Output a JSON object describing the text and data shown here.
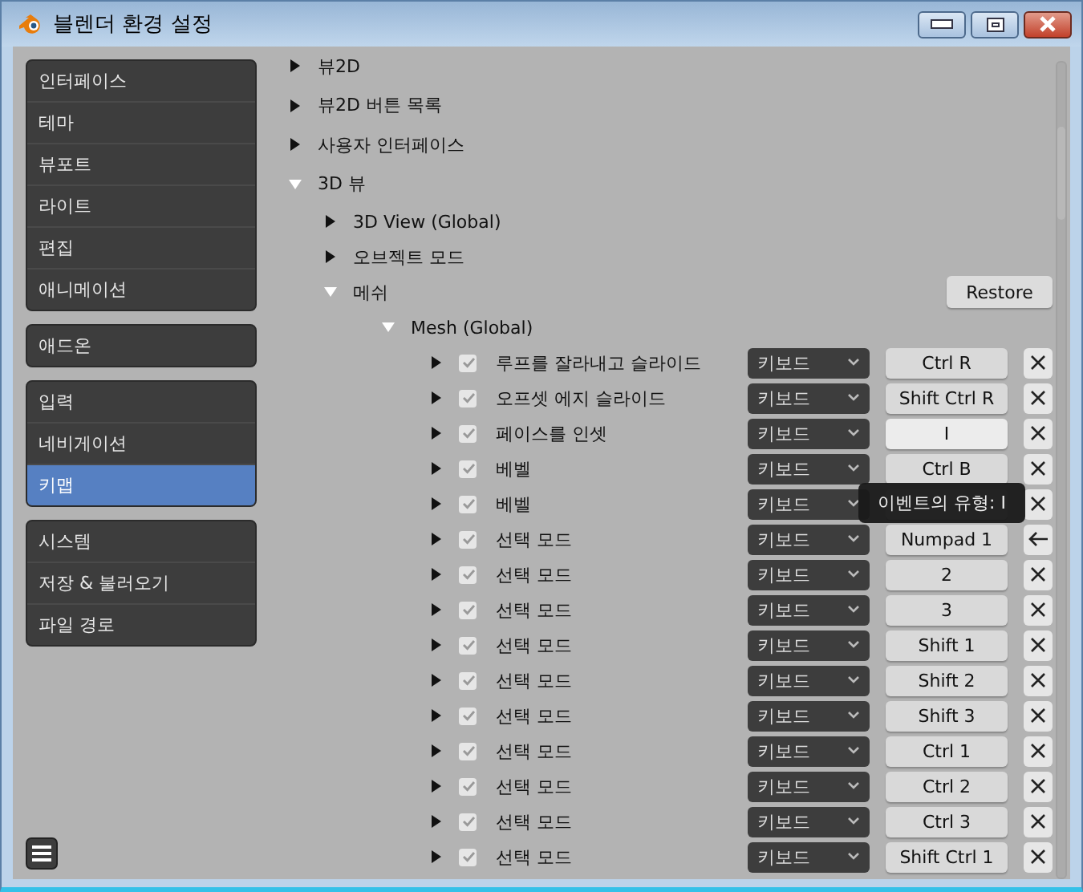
{
  "window": {
    "title": "블렌더 환경 설정"
  },
  "sidebar": {
    "groups": [
      {
        "items": [
          {
            "label": "인터페이스",
            "selected": false
          },
          {
            "label": "테마",
            "selected": false
          },
          {
            "label": "뷰포트",
            "selected": false
          },
          {
            "label": "라이트",
            "selected": false
          },
          {
            "label": "편집",
            "selected": false
          },
          {
            "label": "애니메이션",
            "selected": false
          }
        ]
      },
      {
        "items": [
          {
            "label": "애드온",
            "selected": false
          }
        ]
      },
      {
        "items": [
          {
            "label": "입력",
            "selected": false
          },
          {
            "label": "네비게이션",
            "selected": false
          },
          {
            "label": "키맵",
            "selected": true
          }
        ]
      },
      {
        "items": [
          {
            "label": "시스템",
            "selected": false
          },
          {
            "label": "저장 & 불러오기",
            "selected": false
          },
          {
            "label": "파일 경로",
            "selected": false
          }
        ]
      }
    ]
  },
  "tree": [
    {
      "kind": "section",
      "label": "뷰2D",
      "expanded": false
    },
    {
      "kind": "section",
      "label": "뷰2D 버튼 목록",
      "expanded": false
    },
    {
      "kind": "section",
      "label": "사용자 인터페이스",
      "expanded": false
    },
    {
      "kind": "section",
      "label": "3D 뷰",
      "expanded": true,
      "children": [
        {
          "kind": "section",
          "label": "3D View (Global)",
          "expanded": false
        },
        {
          "kind": "section",
          "label": "오브젝트 모드",
          "expanded": false
        },
        {
          "kind": "section",
          "label": "메쉬",
          "expanded": true,
          "button": "Restore",
          "children": [
            {
              "kind": "section",
              "label": "Mesh (Global)",
              "expanded": true,
              "children": [
                {
                  "kind": "keymap",
                  "label": "루프를 잘라내고 슬라이드",
                  "expanded": false,
                  "checked": true,
                  "input": "키보드",
                  "key": "Ctrl R",
                  "active": false,
                  "modified": false
                },
                {
                  "kind": "keymap",
                  "label": "오프셋 에지 슬라이드",
                  "expanded": false,
                  "checked": true,
                  "input": "키보드",
                  "key": "Shift Ctrl R",
                  "active": false,
                  "modified": false
                },
                {
                  "kind": "keymap",
                  "label": "페이스를 인셋",
                  "expanded": false,
                  "checked": true,
                  "input": "키보드",
                  "key": "I",
                  "active": true,
                  "modified": false
                },
                {
                  "kind": "keymap",
                  "label": "베벨",
                  "expanded": false,
                  "checked": true,
                  "input": "키보드",
                  "key": "Ctrl B",
                  "active": false,
                  "modified": false
                },
                {
                  "kind": "keymap",
                  "label": "베벨",
                  "expanded": false,
                  "checked": true,
                  "input": "키보드",
                  "active": false,
                  "modified": false
                },
                {
                  "kind": "keymap",
                  "label": "선택 모드",
                  "expanded": false,
                  "checked": true,
                  "input": "키보드",
                  "key": "Numpad 1",
                  "active": false,
                  "modified": true
                },
                {
                  "kind": "keymap",
                  "label": "선택 모드",
                  "expanded": false,
                  "checked": true,
                  "input": "키보드",
                  "key": "2",
                  "active": false,
                  "modified": false
                },
                {
                  "kind": "keymap",
                  "label": "선택 모드",
                  "expanded": false,
                  "checked": true,
                  "input": "키보드",
                  "key": "3",
                  "active": false,
                  "modified": false
                },
                {
                  "kind": "keymap",
                  "label": "선택 모드",
                  "expanded": false,
                  "checked": true,
                  "input": "키보드",
                  "key": "Shift 1",
                  "active": false,
                  "modified": false
                },
                {
                  "kind": "keymap",
                  "label": "선택 모드",
                  "expanded": false,
                  "checked": true,
                  "input": "키보드",
                  "key": "Shift 2",
                  "active": false,
                  "modified": false
                },
                {
                  "kind": "keymap",
                  "label": "선택 모드",
                  "expanded": false,
                  "checked": true,
                  "input": "키보드",
                  "key": "Shift 3",
                  "active": false,
                  "modified": false
                },
                {
                  "kind": "keymap",
                  "label": "선택 모드",
                  "expanded": false,
                  "checked": true,
                  "input": "키보드",
                  "key": "Ctrl 1",
                  "active": false,
                  "modified": false
                },
                {
                  "kind": "keymap",
                  "label": "선택 모드",
                  "expanded": false,
                  "checked": true,
                  "input": "키보드",
                  "key": "Ctrl 2",
                  "active": false,
                  "modified": false
                },
                {
                  "kind": "keymap",
                  "label": "선택 모드",
                  "expanded": false,
                  "checked": true,
                  "input": "키보드",
                  "key": "Ctrl 3",
                  "active": false,
                  "modified": false
                },
                {
                  "kind": "keymap",
                  "label": "선택 모드",
                  "expanded": false,
                  "checked": true,
                  "input": "키보드",
                  "key": "Shift Ctrl 1",
                  "active": false,
                  "modified": false
                }
              ]
            }
          ]
        }
      ]
    }
  ],
  "tooltip": {
    "text": "이벤트의 유형: I"
  }
}
